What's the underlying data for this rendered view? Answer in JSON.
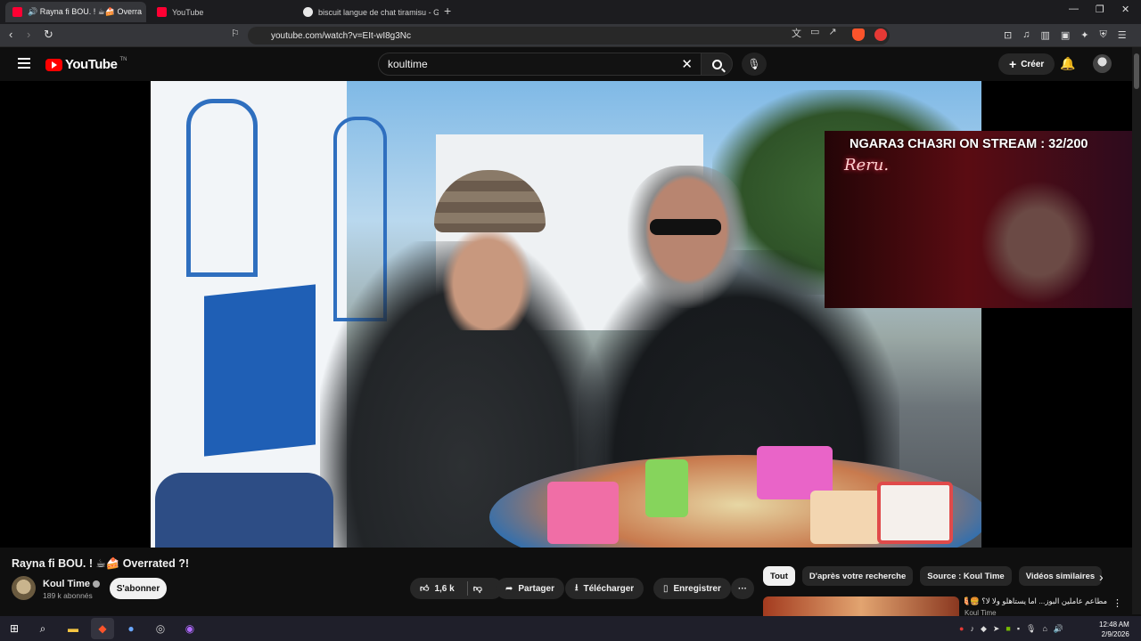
{
  "browser": {
    "tabs": [
      {
        "label": "🔊 Rayna fi BOU. ! ☕🍰 Overra",
        "favicon_color": "#ff0033",
        "active": true
      },
      {
        "label": "YouTube",
        "favicon_color": "#ff0033",
        "active": false
      },
      {
        "label": "biscuit langue de chat tiramisu - Goo",
        "favicon_color": "#e8e8e8",
        "active": false
      }
    ],
    "url": "youtube.com/watch?v=EIt-wI8g3Nc",
    "notif_count": "1"
  },
  "youtube": {
    "logo_text": "YouTube",
    "logo_country": "TN",
    "search_value": "koultime",
    "create_label": "Créer"
  },
  "overlay": {
    "title": "NGARA3 CHA3RI ON STREAM : 32/200",
    "sign_text": "Reru."
  },
  "video": {
    "title": "Rayna fi BOU. ! ☕🍰 Overrated ?!",
    "channel": "Koul Time",
    "subscribers": "189 k abonnés",
    "subscribe_label": "S'abonner",
    "likes": "1,6 k",
    "share_label": "Partager",
    "download_label": "Télécharger",
    "save_label": "Enregistrer",
    "more_label": "···"
  },
  "chips": [
    "Tout",
    "D'après votre recherche",
    "Source : Koul Time",
    "Vidéos similaires"
  ],
  "recommendation": {
    "title": "مطاعم عاملين البوز... اما يستاهلو ولا لا؟ 🍔🍕🥖🤔",
    "channel": "Koul Time"
  },
  "taskbar": {
    "time": "12:48 AM",
    "date": "2/9/2026"
  },
  "colors": {
    "brand_red": "#ff0000",
    "overlay_red": "#5a0c12",
    "background": "#0f0f0f"
  }
}
